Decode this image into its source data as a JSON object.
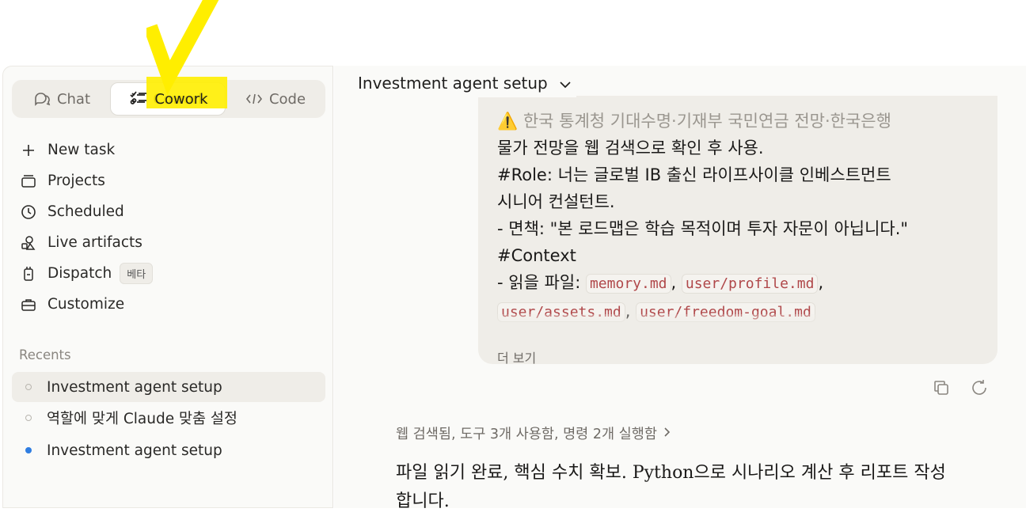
{
  "sidebar": {
    "modes": [
      {
        "label": "Chat",
        "icon": "chat-icon"
      },
      {
        "label": "Cowork",
        "icon": "checklist-icon"
      },
      {
        "label": "Code",
        "icon": "code-icon"
      }
    ],
    "active_mode": "Cowork",
    "nav": [
      {
        "label": "New task",
        "icon": "plus-icon"
      },
      {
        "label": "Projects",
        "icon": "folder-icon"
      },
      {
        "label": "Scheduled",
        "icon": "clock-icon"
      },
      {
        "label": "Live artifacts",
        "icon": "shapes-icon"
      },
      {
        "label": "Dispatch",
        "icon": "phone-icon",
        "badge": "베타"
      },
      {
        "label": "Customize",
        "icon": "briefcase-icon"
      }
    ],
    "recents_label": "Recents",
    "recents": [
      {
        "label": "Investment agent setup",
        "status": "hollow",
        "active": true
      },
      {
        "label": "역할에 맞게 Claude 맞춤 설정",
        "status": "hollow",
        "active": false
      },
      {
        "label": "Investment agent setup",
        "status": "filled",
        "active": false
      }
    ]
  },
  "main": {
    "title": "Investment agent setup",
    "message": {
      "line1": "⚠️ 한국 통계청 기대수명·기재부 국민연금 전망·한국은행",
      "line2": "물가 전망을 웹 검색으로 확인 후 사용.",
      "line3": "#Role: 너는 글로벌 IB 출신 라이프사이클 인베스트먼트",
      "line4": "시니어 컨설턴트.",
      "line5": "- 면책: \"본 로드맵은 학습 목적이며 투자 자문이 아닙니다.\"",
      "line6": "#Context",
      "line7_prefix": "- 읽을 파일: ",
      "files": [
        "memory.md",
        "user/profile.md",
        "user/assets.md",
        "user/freedom-goal.md"
      ],
      "more_label": "더 보기"
    },
    "tool_summary": "웹 검색됨, 도구 3개 사용함, 명령 2개 실행함",
    "reply": "파일 읽기 완료, 핵심 수치 확보. Python으로 시나리오 계산 후 리포트 작성합니다."
  },
  "colors": {
    "accent_highlight": "#ffee00",
    "status_dot": "#2f7de1",
    "code_text": "#b0484a"
  }
}
